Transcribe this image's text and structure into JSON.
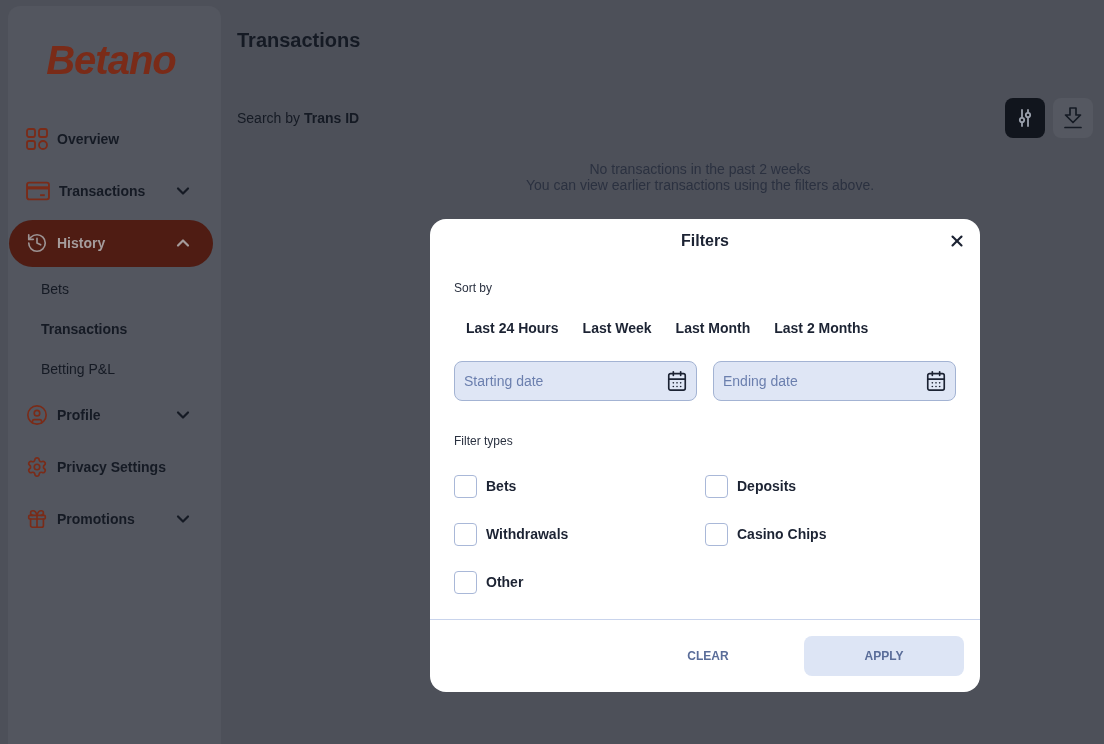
{
  "sidebar": {
    "logo": "Betano",
    "items": [
      {
        "label": "Overview",
        "kind": "grid",
        "selected": false
      },
      {
        "label": "Transactions",
        "kind": "card",
        "selected": false,
        "expanded": false
      },
      {
        "label": "History",
        "kind": "history",
        "selected": true,
        "expanded": true,
        "children": [
          {
            "label": "Bets",
            "selected": false
          },
          {
            "label": "Transactions",
            "selected": true
          },
          {
            "label": "Betting P&L",
            "selected": false
          }
        ]
      },
      {
        "label": "Profile",
        "kind": "user",
        "selected": false,
        "expanded": false
      },
      {
        "label": "Privacy Settings",
        "kind": "gear",
        "selected": false
      },
      {
        "label": "Promotions",
        "kind": "gift",
        "selected": false,
        "expanded": false
      }
    ]
  },
  "page": {
    "title": "Transactions",
    "search_label": "Search by **Trans ID**",
    "toolbar": [
      {
        "kind": "filter",
        "selected": true
      },
      {
        "kind": "download",
        "selected": false
      }
    ],
    "empty_state": [
      "No transactions in the past 2 weeks",
      "You can view earlier transactions using the filters above."
    ]
  },
  "dialog": {
    "title": "Filters",
    "sort_label": "Sort by",
    "periods": [
      {
        "label": "Last 24 Hours",
        "selected": false
      },
      {
        "label": "Last Week",
        "selected": false
      },
      {
        "label": "Last Month",
        "selected": false
      },
      {
        "label": "Last 2 Months",
        "selected": false
      }
    ],
    "date_fields": [
      {
        "placeholder": "Starting date"
      },
      {
        "placeholder": "Ending date"
      }
    ],
    "filter_label": "Filter types",
    "filter_types": [
      {
        "label": "Bets",
        "checked": false
      },
      {
        "label": "Deposits",
        "checked": false
      },
      {
        "label": "Withdrawals",
        "checked": false
      },
      {
        "label": "Casino Chips",
        "checked": false
      },
      {
        "label": "Other",
        "checked": false
      }
    ],
    "buttons": [
      {
        "label": "CLEAR",
        "kind": "text"
      },
      {
        "label": "APPLY",
        "kind": "filled"
      }
    ]
  }
}
